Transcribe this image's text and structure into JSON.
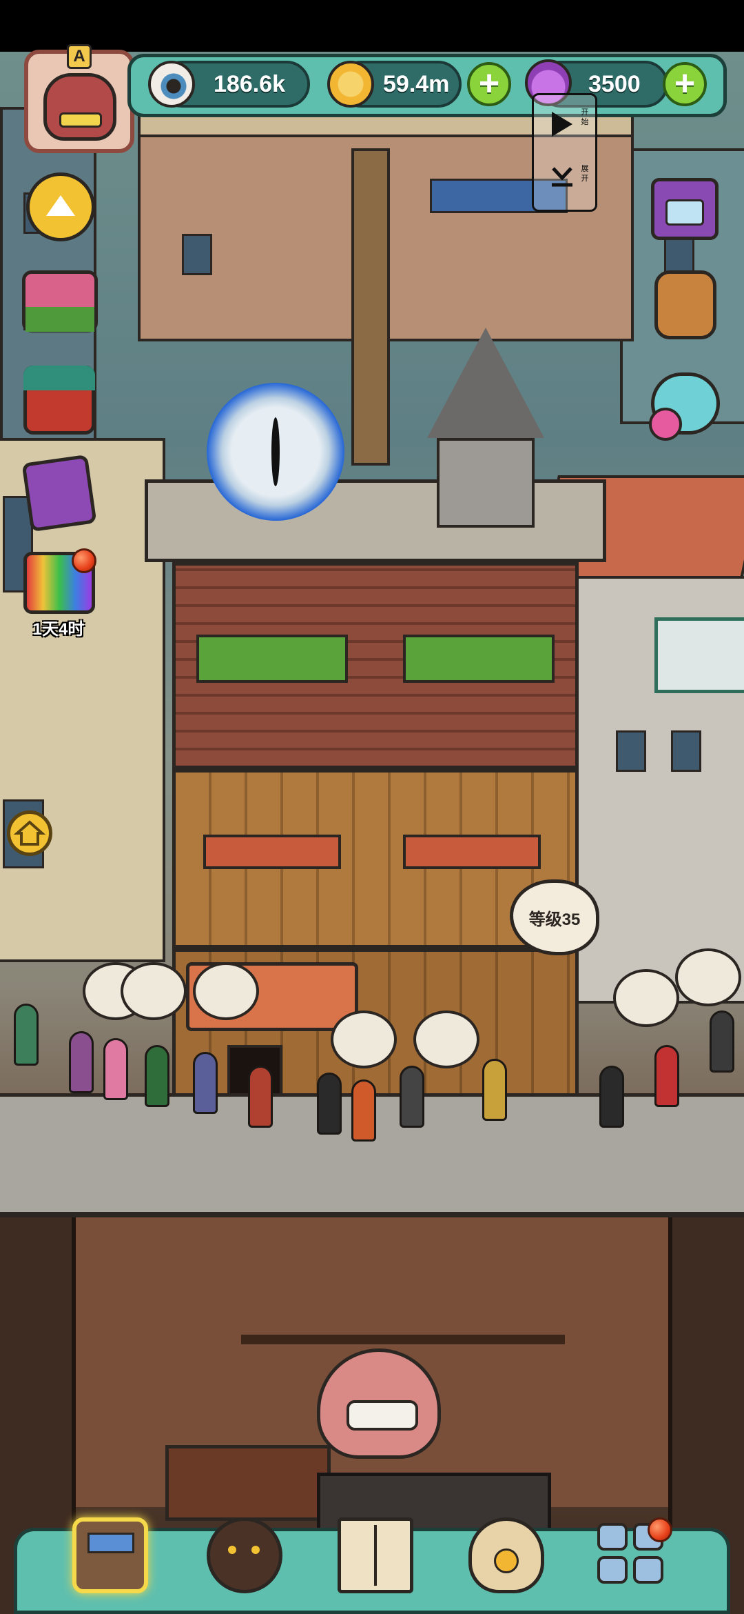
{
  "hud": {
    "eyeballs": "186.6k",
    "coins": "59.4m",
    "potions": "3500"
  },
  "recorder": {
    "start_label": "开始",
    "expand_label": "展开"
  },
  "side_menu": {
    "timer": "1天4时"
  },
  "tower": {
    "level_label": "等级35"
  },
  "colors": {
    "hud_teal": "#5fbfae",
    "plus_green": "#8ad33a",
    "coin_gold": "#f2b632",
    "alert_red": "#e7401a"
  },
  "icons": {
    "top": [
      "eyeball-icon",
      "coin-icon",
      "potion-icon"
    ],
    "left": [
      "collapse-arrow-icon",
      "gift-box-icon",
      "rare-gift-icon",
      "card-pack-icon",
      "rainbow-gift-icon",
      "home-icon"
    ],
    "right": [
      "video-ad-icon",
      "backpack-icon",
      "monster-eggs-icon"
    ],
    "bottom": [
      "shop-building-icon",
      "monster-icon",
      "book-icon",
      "money-bag-icon",
      "grid-menu-icon"
    ]
  }
}
